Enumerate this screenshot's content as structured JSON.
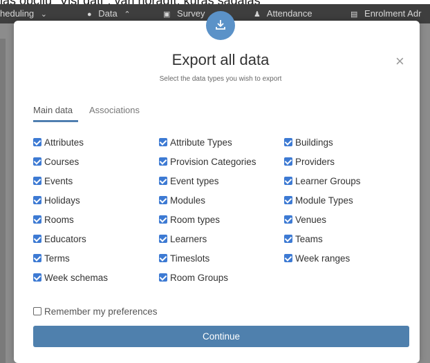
{
  "background": {
    "overlay_text": "las opciju \"Visi dati\", vari norādīt, kuras sadaļas",
    "nav": [
      {
        "label": "heduling",
        "icon": "chevron-down-icon"
      },
      {
        "label": "Data",
        "icon": "database-icon"
      },
      {
        "label": "Survey",
        "icon": "clipboard-icon"
      },
      {
        "label": "Attendance",
        "icon": "person-icon"
      },
      {
        "label": "Enrolment Adr",
        "icon": "document-icon"
      }
    ]
  },
  "modal": {
    "title": "Export all data",
    "subtitle": "Select the data types you wish to export",
    "close_symbol": "×",
    "badge_icon": "download-icon",
    "tabs": [
      {
        "label": "Main data",
        "active": true
      },
      {
        "label": "Associations",
        "active": false
      }
    ],
    "columns": [
      [
        {
          "label": "Attributes",
          "checked": true
        },
        {
          "label": "Courses",
          "checked": true
        },
        {
          "label": "Events",
          "checked": true
        },
        {
          "label": "Holidays",
          "checked": true
        },
        {
          "label": "Rooms",
          "checked": true
        },
        {
          "label": "Educators",
          "checked": true
        },
        {
          "label": "Terms",
          "checked": true
        },
        {
          "label": "Week schemas",
          "checked": true
        }
      ],
      [
        {
          "label": "Attribute Types",
          "checked": true
        },
        {
          "label": "Provision Categories",
          "checked": true
        },
        {
          "label": "Event types",
          "checked": true
        },
        {
          "label": "Modules",
          "checked": true
        },
        {
          "label": "Room types",
          "checked": true
        },
        {
          "label": "Learners",
          "checked": true
        },
        {
          "label": "Timeslots",
          "checked": true
        },
        {
          "label": "Room Groups",
          "checked": true
        }
      ],
      [
        {
          "label": "Buildings",
          "checked": true
        },
        {
          "label": "Providers",
          "checked": true
        },
        {
          "label": "Learner Groups",
          "checked": true
        },
        {
          "label": "Module Types",
          "checked": true
        },
        {
          "label": "Venues",
          "checked": true
        },
        {
          "label": "Teams",
          "checked": true
        },
        {
          "label": "Week ranges",
          "checked": true
        }
      ]
    ],
    "remember_label": "Remember my preferences",
    "remember_checked": false,
    "continue_label": "Continue"
  }
}
